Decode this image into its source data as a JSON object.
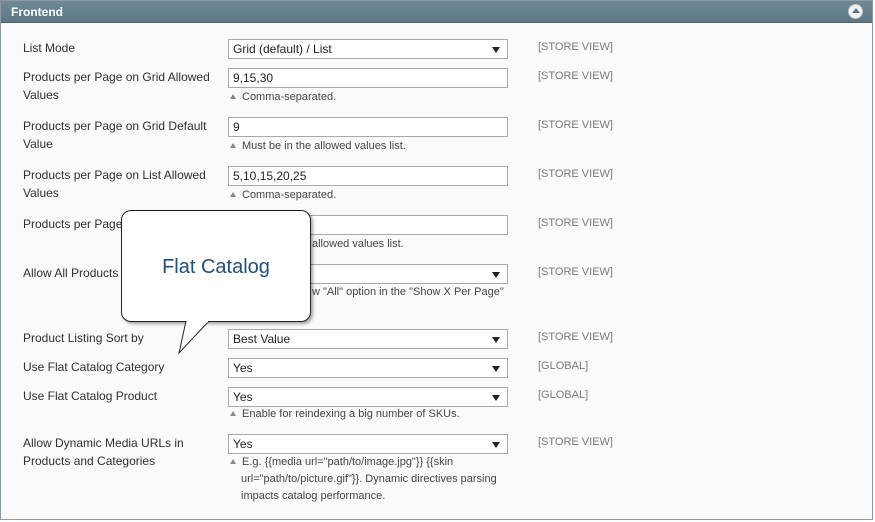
{
  "header": {
    "title": "Frontend"
  },
  "fields": [
    {
      "label": "List Mode",
      "value": "Grid (default) / List",
      "scope": "[STORE VIEW]"
    },
    {
      "label": "Products per Page on Grid Allowed Values",
      "value": "9,15,30",
      "note": "Comma-separated.",
      "scope": "[STORE VIEW]"
    },
    {
      "label": "Products per Page on Grid Default Value",
      "value": "9",
      "note": "Must be in the allowed values list.",
      "scope": "[STORE VIEW]"
    },
    {
      "label": "Products per Page on List Allowed Values",
      "value": "5,10,15,20,25",
      "note": "Comma-separated.",
      "scope": "[STORE VIEW]"
    },
    {
      "label": "Products per Page Value",
      "value": "",
      "note": "allowed values list.",
      "scope": "[STORE VIEW]"
    },
    {
      "label": "Allow All Products",
      "value": "",
      "note": "w \"All\" option in the \"Show X Per Page\"",
      "scope": "[STORE VIEW]"
    },
    {
      "label": "Product Listing Sort by",
      "value": "Best Value",
      "scope": "[STORE VIEW]"
    },
    {
      "label": "Use Flat Catalog Category",
      "value": "Yes",
      "scope": "[GLOBAL]"
    },
    {
      "label": "Use Flat Catalog Product",
      "value": "Yes",
      "note": "Enable for reindexing a big number of SKUs.",
      "scope": "[GLOBAL]"
    },
    {
      "label": "Allow Dynamic Media URLs in Products and Categories",
      "value": "Yes",
      "note_lines": [
        "E.g. {{media url=\"path/to/image.jpg\"}} {{skin",
        "url=\"path/to/picture.gif\"}}. Dynamic directives parsing",
        "impacts catalog performance."
      ],
      "scope": "[STORE VIEW]"
    }
  ],
  "callout": {
    "text": "Flat Catalog"
  },
  "icons": {
    "collapse": "collapse-up-icon",
    "dropdown": "chevron-down-icon",
    "note": "note-triangle-icon"
  }
}
